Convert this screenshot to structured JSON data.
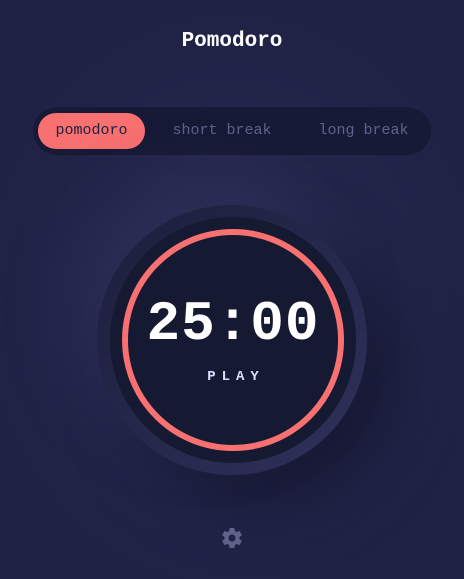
{
  "app": {
    "title": "Pomodoro"
  },
  "modes": [
    {
      "label": "pomodoro",
      "active": true
    },
    {
      "label": "short break",
      "active": false
    },
    {
      "label": "long break",
      "active": false
    }
  ],
  "timer": {
    "time": "25:00",
    "action_label": "PLAY",
    "progress": 1.0
  },
  "icons": {
    "settings": "gear-icon"
  },
  "colors": {
    "accent": "#f87070",
    "background": "#1e2140",
    "surface": "#161932",
    "text": "#ffffff",
    "muted": "#5f6389"
  }
}
